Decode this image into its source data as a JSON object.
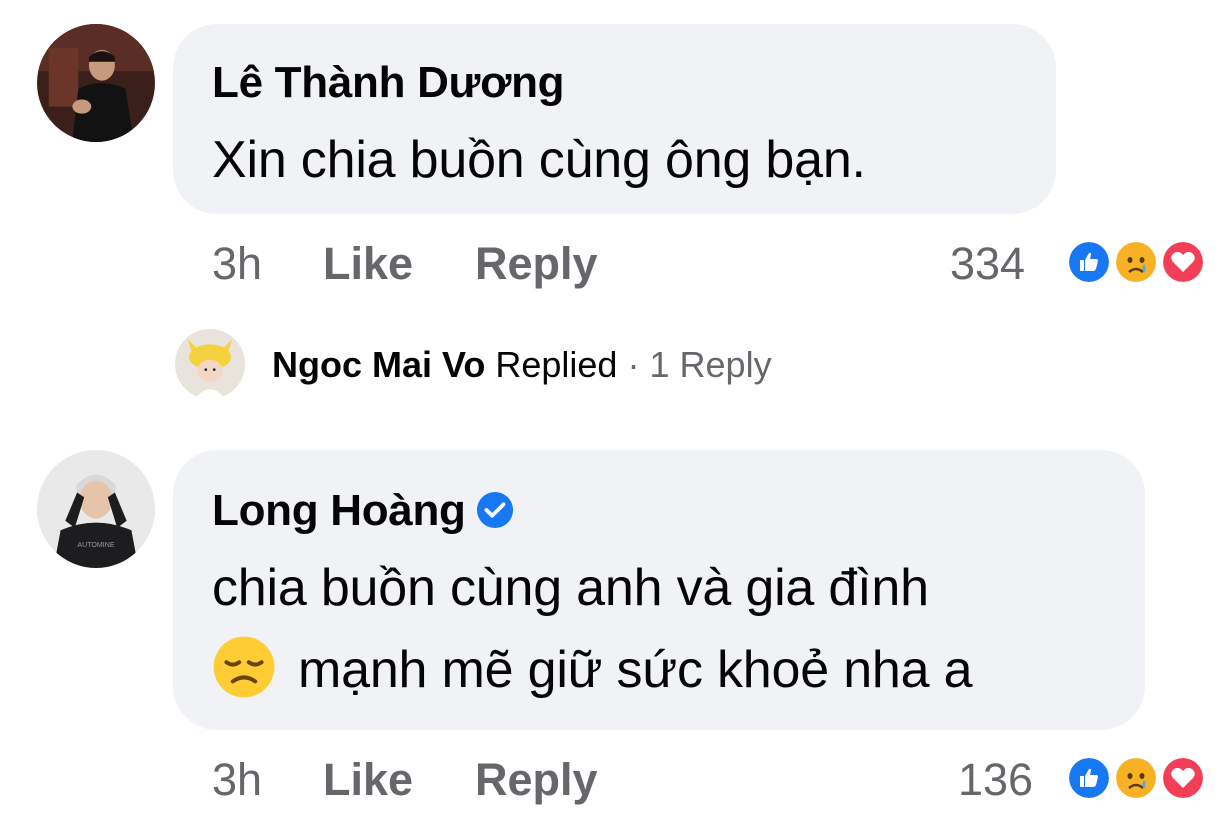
{
  "comments": [
    {
      "author": "Lê Thành Dương",
      "text": "Xin chia buồn cùng ông bạn.",
      "time": "3h",
      "like_label": "Like",
      "reply_label": "Reply",
      "reaction_count": "334",
      "reactions": [
        "like-reaction-icon",
        "sad-reaction-icon",
        "love-reaction-icon"
      ]
    },
    {
      "author": "Long Hoàng",
      "verified": true,
      "text_line1": "chia buồn cùng anh và gia đình",
      "text_line2": "mạnh mẽ giữ sức khoẻ nha a",
      "emoji": "disappointed-face-emoji",
      "time": "3h",
      "like_label": "Like",
      "reply_label": "Reply",
      "reaction_count": "136",
      "reactions": [
        "like-reaction-icon",
        "sad-reaction-icon",
        "love-reaction-icon"
      ]
    }
  ],
  "reply_summary": {
    "author": "Ngoc Mai Vo",
    "action": "Replied",
    "separator": "·",
    "count_label": "1 Reply"
  },
  "colors": {
    "bubble": "#f0f2f5",
    "meta_text": "#65676b",
    "like_blue": "#1877f2",
    "love_red": "#f33e58",
    "sad_yellow": "#f7b125"
  }
}
